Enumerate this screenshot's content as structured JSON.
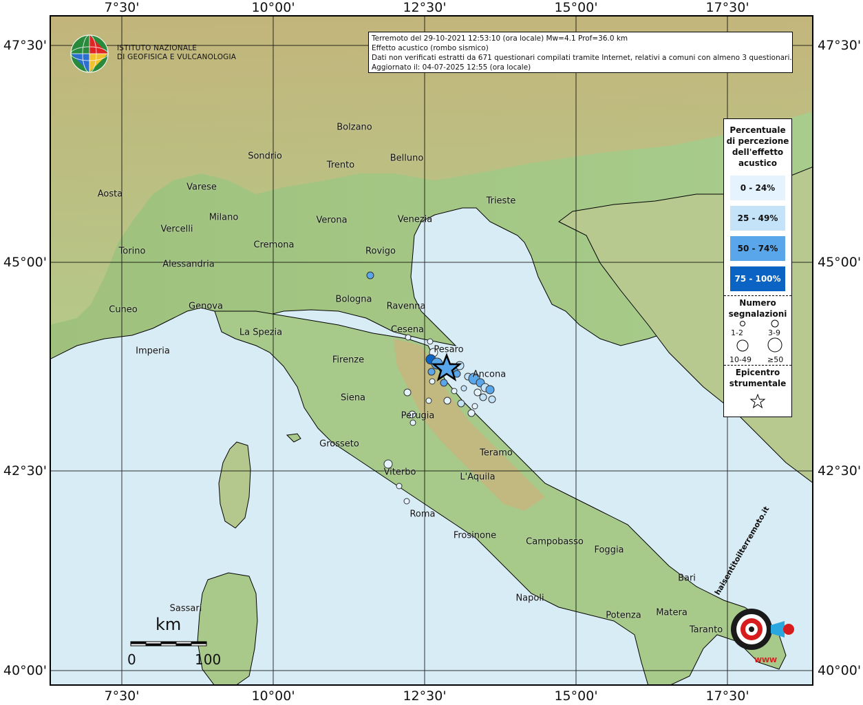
{
  "axes": {
    "lon_labels": [
      "7°30'",
      "10°00'",
      "12°30'",
      "15°00'",
      "17°30'"
    ],
    "lat_labels": [
      "47°30'",
      "45°00'",
      "42°30'",
      "40°00'"
    ]
  },
  "info_box": {
    "line1": "Terremoto del 29-10-2021 12:53:10 (ora locale) Mw=4.1 Prof=36.0 km",
    "line2": "Effetto acustico (rombo sismico)",
    "line3": "Dati non verificati estratti da 671 questionari compilati tramite Internet, relativi a comuni con almeno 3 questionari.",
    "line4": "Aggiornato il: 04-07-2025 12:55 (ora locale)"
  },
  "logo": {
    "line1": "ISTITUTO NAZIONALE",
    "line2": "DI GEOFISICA E VULCANOLOGIA"
  },
  "legend": {
    "title": [
      "Percentuale",
      "di percezione",
      "dell'effetto",
      "acustico"
    ],
    "classes": [
      {
        "label": "0 - 24%",
        "color": "#e4f3fe"
      },
      {
        "label": "25 - 49%",
        "color": "#c4e2f8"
      },
      {
        "label": "50 - 74%",
        "color": "#5aa6ea"
      },
      {
        "label": "75 - 100%",
        "color": "#0b63c4"
      }
    ],
    "count_title": [
      "Numero",
      "segnalazioni"
    ],
    "count_labels": [
      "1-2",
      "3-9",
      "10-49",
      "≥50"
    ],
    "epicenter_title": [
      "Epicentro",
      "strumentale"
    ]
  },
  "cities": [
    {
      "name": "Bolzano"
    },
    {
      "name": "Sondrio"
    },
    {
      "name": "Trento"
    },
    {
      "name": "Belluno"
    },
    {
      "name": "Aosta"
    },
    {
      "name": "Varese"
    },
    {
      "name": "Milano"
    },
    {
      "name": "Vercelli"
    },
    {
      "name": "Verona"
    },
    {
      "name": "Venezia"
    },
    {
      "name": "Trieste"
    },
    {
      "name": "Torino"
    },
    {
      "name": "Cremona"
    },
    {
      "name": "Alessandria"
    },
    {
      "name": "Rovigo"
    },
    {
      "name": "Cuneo"
    },
    {
      "name": "Genova"
    },
    {
      "name": "Bologna"
    },
    {
      "name": "Ravenna"
    },
    {
      "name": "La Spezia"
    },
    {
      "name": "Cesena"
    },
    {
      "name": "Imperia"
    },
    {
      "name": "Pesaro"
    },
    {
      "name": "Firenze"
    },
    {
      "name": "Ancona"
    },
    {
      "name": "Siena"
    },
    {
      "name": "Perugia"
    },
    {
      "name": "Grosseto"
    },
    {
      "name": "Teramo"
    },
    {
      "name": "Viterbo"
    },
    {
      "name": "L'Aquila"
    },
    {
      "name": "Roma"
    },
    {
      "name": "Frosinone"
    },
    {
      "name": "Campobasso"
    },
    {
      "name": "Foggia"
    },
    {
      "name": "Bari"
    },
    {
      "name": "Sassari"
    },
    {
      "name": "Napoli"
    },
    {
      "name": "Potenza"
    },
    {
      "name": "Matera"
    },
    {
      "name": "Taranto"
    }
  ],
  "scalebar": {
    "unit": "km",
    "start": "0",
    "end": "100"
  },
  "watermark": {
    "text": "haisentitoilterremoto.it",
    "www": "WWW"
  },
  "colors": {
    "sea": "#d8ecf6",
    "land": "#a9c98e",
    "border": "#000000"
  }
}
